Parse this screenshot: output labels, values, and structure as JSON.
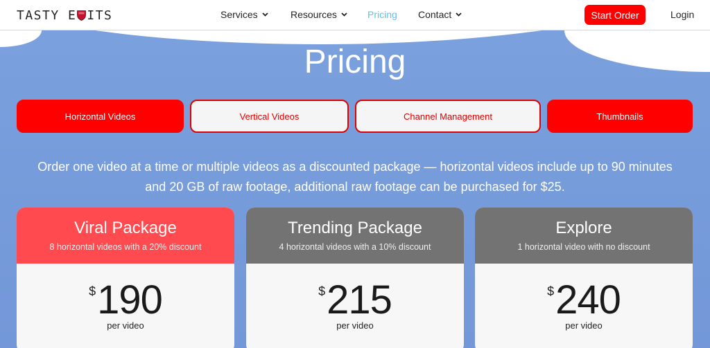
{
  "nav": {
    "logo_left": "TASTY E",
    "logo_right": "ITS",
    "items": [
      {
        "label": "Services",
        "dropdown": true
      },
      {
        "label": "Resources",
        "dropdown": true
      },
      {
        "label": "Pricing",
        "dropdown": false
      },
      {
        "label": "Contact",
        "dropdown": true
      }
    ],
    "start_order": "Start Order",
    "login": "Login"
  },
  "hero": {
    "title": "Pricing",
    "tabs": [
      "Horizontal Videos",
      "Vertical Videos",
      "Channel Management",
      "Thumbnails"
    ],
    "description": "Order one video at a time or multiple videos as a discounted package — horizontal videos include up to 90 minutes and 20 GB of raw footage, additional raw footage can be purchased for $25."
  },
  "cards": [
    {
      "name": "Viral Package",
      "sub": "8 horizontal videos with a 20% discount",
      "currency": "$",
      "price": "190",
      "per": "per video",
      "color": "#ff4a4f"
    },
    {
      "name": "Trending Package",
      "sub": "4 horizontal videos with a 10% discount",
      "currency": "$",
      "price": "215",
      "per": "per video",
      "color": "#737373"
    },
    {
      "name": "Explore",
      "sub": "1 horizontal video with no discount",
      "currency": "$",
      "price": "240",
      "per": "per video",
      "color": "#737373"
    }
  ],
  "colors": {
    "accent": "#ff0000",
    "active_nav": "#5bc3e6",
    "hero_bg": "#7aa0dd"
  }
}
